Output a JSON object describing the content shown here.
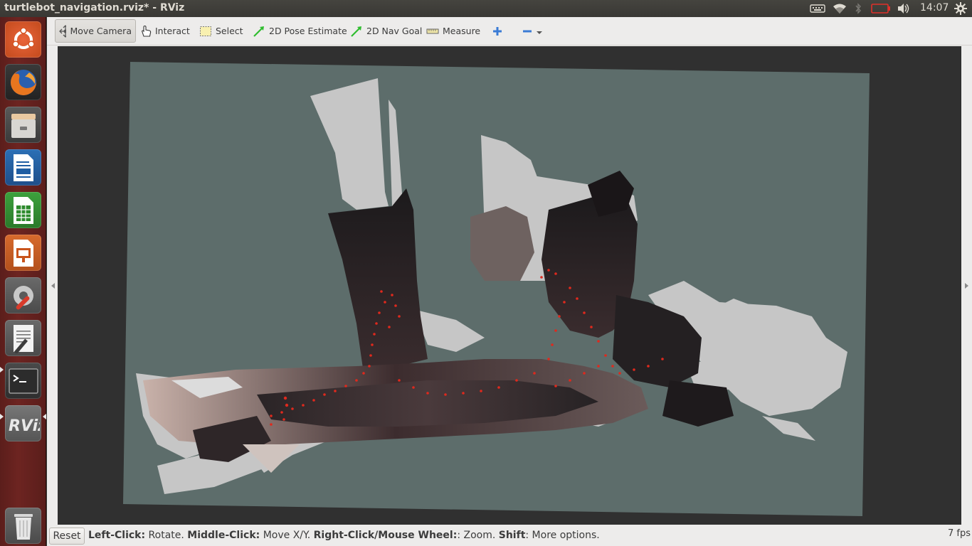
{
  "panel": {
    "window_title": "turtlebot_navigation.rviz* - RViz",
    "clock": "14:07",
    "tray_icons": [
      "keyboard-icon",
      "wifi-icon",
      "bluetooth-icon",
      "battery-icon",
      "volume-icon",
      "settings-gear-icon"
    ]
  },
  "launcher": {
    "items": [
      "ubuntu-dash",
      "firefox",
      "files",
      "libreoffice-writer",
      "libreoffice-calc",
      "libreoffice-impress",
      "system-settings",
      "text-editor",
      "terminal",
      "rviz",
      "trash"
    ]
  },
  "toolbar": {
    "move_camera": "Move Camera",
    "interact": "Interact",
    "select": "Select",
    "pose_estimate": "2D Pose Estimate",
    "nav_goal": "2D Nav Goal",
    "measure": "Measure"
  },
  "status": {
    "reset": "Reset",
    "left_click_key": "Left-Click:",
    "left_click_val": " Rotate. ",
    "middle_click_key": "Middle-Click:",
    "middle_click_val": " Move X/Y. ",
    "right_click_key": "Right-Click/Mouse Wheel:",
    "right_click_val": ": Zoom. ",
    "shift_key": "Shift",
    "shift_val": ": More options.",
    "fps": "7 fps"
  },
  "colors": {
    "grid_plane": "#5d6d6b",
    "viewport_bg": "#303030",
    "launcher_bg": "#6d2421",
    "free_space": "#c8c8c8",
    "path_points": "#e0291d"
  }
}
